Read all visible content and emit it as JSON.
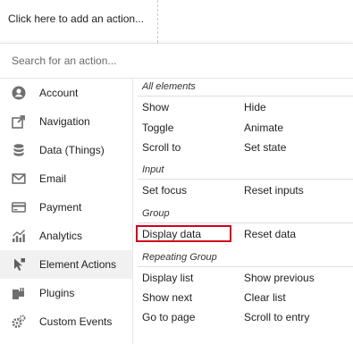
{
  "top": {
    "add_action": "Click here to add an action..."
  },
  "search": {
    "placeholder": "Search for an action..."
  },
  "categories": [
    {
      "label": "Account",
      "icon": "account-icon"
    },
    {
      "label": "Navigation",
      "icon": "navigation-icon"
    },
    {
      "label": "Data (Things)",
      "icon": "database-icon"
    },
    {
      "label": "Email",
      "icon": "email-icon"
    },
    {
      "label": "Payment",
      "icon": "payment-icon"
    },
    {
      "label": "Analytics",
      "icon": "analytics-icon"
    },
    {
      "label": "Element Actions",
      "icon": "cursor-icon",
      "selected": true
    },
    {
      "label": "Plugins",
      "icon": "plugins-icon"
    },
    {
      "label": "Custom Events",
      "icon": "gears-icon"
    }
  ],
  "groups": {
    "all_elements": {
      "title": "All elements",
      "items": [
        "Show",
        "Hide",
        "Toggle",
        "Animate",
        "Scroll to",
        "Set state"
      ]
    },
    "input": {
      "title": "Input",
      "items": [
        "Set focus",
        "Reset inputs"
      ]
    },
    "group": {
      "title": "Group",
      "items": [
        "Display data",
        "Reset data"
      ]
    },
    "repeating_group": {
      "title": "Repeating Group",
      "items": [
        "Display list",
        "Show previous",
        "Show next",
        "Clear list",
        "Go to page",
        "Scroll to entry"
      ]
    }
  },
  "highlight": {
    "item": "Display data",
    "color": "#d0021b"
  }
}
